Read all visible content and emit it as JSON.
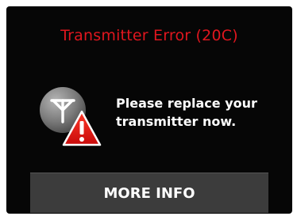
{
  "alert": {
    "title": "Transmitter Error (20C)",
    "message": "Please replace your\ntransmitter now.",
    "icon": "transmitter-warning-icon",
    "title_color": "#e0161e"
  },
  "actions": {
    "more_info_label": "MORE INFO"
  }
}
